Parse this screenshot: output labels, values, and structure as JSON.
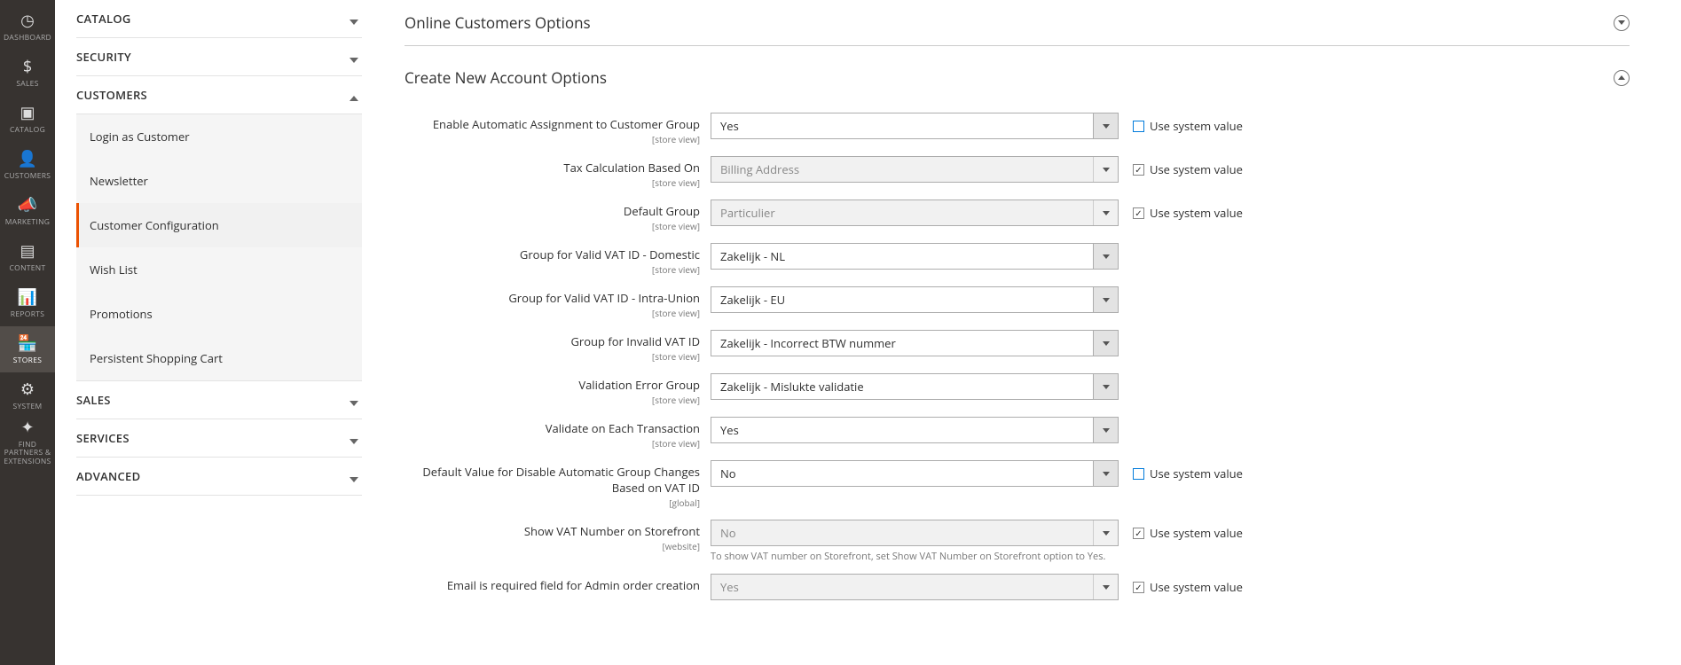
{
  "nav": [
    {
      "label": "DASHBOARD",
      "icon": "◷"
    },
    {
      "label": "SALES",
      "icon": "$"
    },
    {
      "label": "CATALOG",
      "icon": "▣"
    },
    {
      "label": "CUSTOMERS",
      "icon": "👤"
    },
    {
      "label": "MARKETING",
      "icon": "📣"
    },
    {
      "label": "CONTENT",
      "icon": "▤"
    },
    {
      "label": "REPORTS",
      "icon": "📊"
    },
    {
      "label": "STORES",
      "icon": "🏪",
      "active": true
    },
    {
      "label": "SYSTEM",
      "icon": "⚙"
    },
    {
      "label": "FIND PARTNERS & EXTENSIONS",
      "icon": "✦"
    }
  ],
  "sidebar": {
    "sections": [
      {
        "label": "CATALOG",
        "expanded": false
      },
      {
        "label": "SECURITY",
        "expanded": false
      },
      {
        "label": "CUSTOMERS",
        "expanded": true,
        "items": [
          {
            "label": "Login as Customer"
          },
          {
            "label": "Newsletter"
          },
          {
            "label": "Customer Configuration",
            "active": true
          },
          {
            "label": "Wish List"
          },
          {
            "label": "Promotions"
          },
          {
            "label": "Persistent Shopping Cart"
          }
        ]
      },
      {
        "label": "SALES",
        "expanded": false
      },
      {
        "label": "SERVICES",
        "expanded": false
      },
      {
        "label": "ADVANCED",
        "expanded": false
      }
    ]
  },
  "sections": {
    "online": {
      "title": "Online Customers Options"
    },
    "create": {
      "title": "Create New Account Options"
    }
  },
  "scopes": {
    "store": "[store view]",
    "global": "[global]",
    "website": "[website]"
  },
  "useSystemLabel": "Use system value",
  "fields": {
    "autoAssign": {
      "label": "Enable Automatic Assignment to Customer Group",
      "value": "Yes",
      "use": false,
      "disabled": false
    },
    "taxCalc": {
      "label": "Tax Calculation Based On",
      "value": "Billing Address",
      "use": true,
      "disabled": true
    },
    "defaultGroup": {
      "label": "Default Group",
      "value": "Particulier",
      "use": true,
      "disabled": true
    },
    "validDomestic": {
      "label": "Group for Valid VAT ID - Domestic",
      "value": "Zakelijk - NL",
      "disabled": false
    },
    "validIntra": {
      "label": "Group for Valid VAT ID - Intra-Union",
      "value": "Zakelijk - EU",
      "disabled": false
    },
    "invalidVat": {
      "label": "Group for Invalid VAT ID",
      "value": "Zakelijk - Incorrect BTW nummer",
      "disabled": false
    },
    "validationErr": {
      "label": "Validation Error Group",
      "value": "Zakelijk - Mislukte validatie",
      "disabled": false
    },
    "validateEach": {
      "label": "Validate on Each Transaction",
      "value": "Yes",
      "disabled": false
    },
    "disableAutoVat": {
      "label": "Default Value for Disable Automatic Group Changes Based on VAT ID",
      "value": "No",
      "use": false,
      "disabled": false,
      "scope": "global"
    },
    "showVat": {
      "label": "Show VAT Number on Storefront",
      "value": "No",
      "use": true,
      "disabled": true,
      "scope": "website",
      "note": "To show VAT number on Storefront, set Show VAT Number on Storefront option to Yes."
    },
    "emailReq": {
      "label": "Email is required field for Admin order creation",
      "value": "Yes",
      "use": true,
      "disabled": true
    }
  }
}
